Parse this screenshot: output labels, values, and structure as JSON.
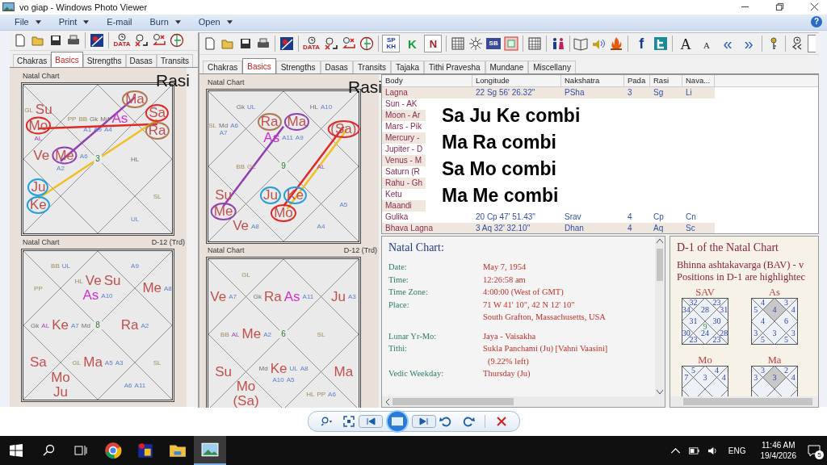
{
  "window": {
    "title": "vo giap - Windows Photo Viewer"
  },
  "menu": [
    {
      "label": "File",
      "dropdown": true
    },
    {
      "label": "Print",
      "dropdown": true
    },
    {
      "label": "E-mail",
      "dropdown": false
    },
    {
      "label": "Burn",
      "dropdown": true
    },
    {
      "label": "Open",
      "dropdown": true
    }
  ],
  "help": "?",
  "back_window": {
    "toolbar": [
      {
        "kind": "new"
      },
      {
        "kind": "open"
      },
      {
        "kind": "save"
      },
      {
        "kind": "print"
      },
      {
        "kind": "logo",
        "group_start": true
      },
      {
        "kind": "data",
        "text": "DATA",
        "group_start": true
      },
      {
        "kind": "clock-x"
      },
      {
        "kind": "clock-back"
      },
      {
        "kind": "globe"
      }
    ],
    "tabs": [
      {
        "label": "Chakras",
        "selected": false
      },
      {
        "label": "Basics",
        "selected": true
      },
      {
        "label": "Strengths",
        "selected": false
      },
      {
        "label": "Dasas",
        "selected": false
      },
      {
        "label": "Transits",
        "selected": false
      }
    ],
    "charts": [
      {
        "title": "Natal Chart",
        "varga": "Rasi",
        "kind": "stamp",
        "center": "3",
        "houses": [
          {
            "kind": "top-right",
            "labels": [
              {
                "text": "Ma",
                "kind": "planet",
                "circled": true,
                "color": "#b07850"
              }
            ]
          },
          {
            "kind": "left-top",
            "labels": [
              {
                "text": "GL",
                "kind": "special"
              },
              {
                "text": "Su",
                "kind": "planet",
                "circled": false
              },
              {
                "text": "Mo",
                "kind": "planet",
                "circled": true,
                "color": "#e02828"
              },
              {
                "text": "AL",
                "kind": "arudha-lagna"
              }
            ]
          },
          {
            "kind": "top",
            "labels": [
              {
                "text": "PP",
                "kind": "special"
              },
              {
                "text": "BB",
                "kind": "special"
              },
              {
                "text": "Gk",
                "kind": "upagraha"
              },
              {
                "text": "Md",
                "kind": "upagraha"
              },
              {
                "text": "As",
                "kind": "lagna"
              },
              {
                "text": "A1",
                "kind": "arudha"
              },
              {
                "text": "A9",
                "kind": "arudha"
              },
              {
                "text": "A4",
                "kind": "arudha"
              }
            ]
          },
          {
            "kind": "right-top",
            "labels": [
              {
                "text": "Sa",
                "kind": "planet",
                "circled": true,
                "color": "#e02828"
              },
              {
                "text": "Ra",
                "kind": "planet",
                "circled": true,
                "color": "#b07850"
              }
            ]
          },
          {
            "kind": "left",
            "labels": [
              {
                "text": "Ve",
                "kind": "planet",
                "circled": false
              },
              {
                "text": "Me",
                "kind": "planet",
                "circled": true,
                "color": "#9040b0"
              },
              {
                "text": "A6",
                "kind": "arudha"
              },
              {
                "text": "A2",
                "kind": "arudha"
              }
            ]
          },
          {
            "kind": "right",
            "labels": [
              {
                "text": "HL",
                "kind": "upagraha"
              }
            ]
          },
          {
            "kind": "left-bottom",
            "labels": [
              {
                "text": "Ju",
                "kind": "planet",
                "circled": true,
                "color": "#20a0e0"
              },
              {
                "text": "Ke",
                "kind": "planet",
                "circled": true,
                "color": "#20a0e0"
              }
            ]
          },
          {
            "kind": "right-bottom",
            "labels": [
              {
                "text": "SL",
                "kind": "special"
              }
            ]
          },
          {
            "kind": "bottom-right",
            "labels": [
              {
                "text": "UL",
                "kind": "arudha"
              }
            ]
          }
        ],
        "links": [
          {
            "kind": "left-to-top-right",
            "color": "#9040b0"
          },
          {
            "kind": "left-top-to-right-top",
            "color": "#e02828"
          },
          {
            "kind": "left-bottom-to-right-top",
            "color": "#f0c020"
          }
        ]
      },
      {
        "title": "Natal Chart",
        "varga": "D-12 (Trd)",
        "kind": "caption",
        "center": "8",
        "houses": [
          {
            "kind": "top-left",
            "labels": [
              {
                "text": "BB",
                "kind": "special"
              },
              {
                "text": "UL",
                "kind": "arudha"
              }
            ]
          },
          {
            "kind": "top-right",
            "labels": [
              {
                "text": "A9",
                "kind": "arudha"
              }
            ]
          },
          {
            "kind": "left-top",
            "labels": [
              {
                "text": "PP",
                "kind": "special"
              }
            ]
          },
          {
            "kind": "top",
            "labels": [
              {
                "text": "HL",
                "kind": "special"
              },
              {
                "text": "Ve",
                "kind": "planet",
                "circled": false
              },
              {
                "text": "Su",
                "kind": "planet",
                "circled": false
              },
              {
                "text": "As",
                "kind": "lagna"
              },
              {
                "text": "A10",
                "kind": "arudha"
              }
            ]
          },
          {
            "kind": "right-top",
            "labels": [
              {
                "text": "Me",
                "kind": "planet",
                "circled": false
              },
              {
                "text": "A8",
                "kind": "arudha"
              }
            ]
          },
          {
            "kind": "left",
            "labels": [
              {
                "text": "Gk",
                "kind": "upagraha"
              },
              {
                "text": "AL",
                "kind": "arudha-lagna"
              },
              {
                "text": "Ke",
                "kind": "planet",
                "circled": false
              },
              {
                "text": "A7",
                "kind": "arudha"
              },
              {
                "text": "Md",
                "kind": "upagraha"
              }
            ]
          },
          {
            "kind": "right",
            "labels": [
              {
                "text": "Ra",
                "kind": "planet",
                "circled": false
              },
              {
                "text": "A2",
                "kind": "arudha"
              }
            ]
          },
          {
            "kind": "left-bottom",
            "labels": [
              {
                "text": "Sa",
                "kind": "planet",
                "circled": false
              }
            ]
          },
          {
            "kind": "bottom",
            "labels": [
              {
                "text": "GL",
                "kind": "special"
              },
              {
                "text": "Ma",
                "kind": "planet",
                "circled": false
              },
              {
                "text": "A5",
                "kind": "arudha"
              },
              {
                "text": "A3",
                "kind": "arudha"
              }
            ]
          },
          {
            "kind": "right-bottom",
            "labels": [
              {
                "text": "SL",
                "kind": "special"
              }
            ]
          },
          {
            "kind": "bottom-left",
            "labels": [
              {
                "text": "Mo",
                "kind": "planet",
                "circled": false
              },
              {
                "text": "Ju",
                "kind": "planet",
                "circled": false
              }
            ]
          },
          {
            "kind": "bottom-right",
            "labels": [
              {
                "text": "A6",
                "kind": "arudha"
              },
              {
                "text": "A11",
                "kind": "arudha"
              }
            ]
          }
        ]
      }
    ]
  },
  "front_window": {
    "toolbar": [
      {
        "kind": "new"
      },
      {
        "kind": "open"
      },
      {
        "kind": "save"
      },
      {
        "kind": "print"
      },
      {
        "kind": "logo",
        "group_start": true
      },
      {
        "kind": "data",
        "text": "DATA",
        "group_start": true
      },
      {
        "kind": "clock-x"
      },
      {
        "kind": "clock-back"
      },
      {
        "kind": "globe"
      },
      {
        "kind": "sp",
        "lines": [
          "SP",
          "KH"
        ],
        "group_start": true
      },
      {
        "kind": "k",
        "text": "K"
      },
      {
        "kind": "n",
        "text": "N"
      },
      {
        "kind": "grid",
        "group_start": true
      },
      {
        "kind": "sun"
      },
      {
        "kind": "sb",
        "text": "SB"
      },
      {
        "kind": "square"
      },
      {
        "kind": "grid",
        "group_start": true
      },
      {
        "kind": "people",
        "group_start": true
      },
      {
        "kind": "book",
        "group_start": true
      },
      {
        "kind": "speaker"
      },
      {
        "kind": "fire"
      },
      {
        "kind": "f",
        "text": "f",
        "group_start": true
      },
      {
        "kind": "bird-box"
      },
      {
        "kind": "big-a",
        "text": "A",
        "group_start": true
      },
      {
        "kind": "small-a",
        "text": "A"
      },
      {
        "kind": "prev",
        "text": "«"
      },
      {
        "kind": "next",
        "text": "»"
      },
      {
        "kind": "key",
        "group_start": true
      },
      {
        "kind": "clock-prev",
        "group_start": true
      },
      {
        "kind": "field"
      }
    ],
    "tabs": [
      {
        "label": "Chakras",
        "selected": false
      },
      {
        "label": "Basics",
        "selected": true
      },
      {
        "label": "Strengths",
        "selected": false
      },
      {
        "label": "Dasas",
        "selected": false
      },
      {
        "label": "Transits",
        "selected": false
      },
      {
        "label": "Tajaka",
        "selected": false
      },
      {
        "label": "Tithi Pravesha",
        "selected": false
      },
      {
        "label": "Mundane",
        "selected": false
      },
      {
        "label": "Miscellany",
        "selected": false
      }
    ],
    "charts": [
      {
        "title": "Natal Chart",
        "varga": "Rasi",
        "kind": "stamp",
        "center": "9",
        "houses": [
          {
            "kind": "top-left",
            "labels": [
              {
                "text": "Gk",
                "kind": "upagraha"
              },
              {
                "text": "UL",
                "kind": "arudha"
              }
            ]
          },
          {
            "kind": "top-right",
            "labels": [
              {
                "text": "HL",
                "kind": "upagraha"
              },
              {
                "text": "A10",
                "kind": "arudha"
              }
            ]
          },
          {
            "kind": "left-top",
            "labels": [
              {
                "text": "SL",
                "kind": "special"
              },
              {
                "text": "Md",
                "kind": "upagraha"
              },
              {
                "text": "A6",
                "kind": "arudha"
              },
              {
                "text": "A7",
                "kind": "arudha"
              }
            ]
          },
          {
            "kind": "top",
            "labels": [
              {
                "text": "Ra",
                "kind": "planet",
                "circled": true,
                "color": "#b07850"
              },
              {
                "text": "Ma",
                "kind": "planet",
                "circled": true,
                "color": "#9040b0"
              },
              {
                "text": "As",
                "kind": "lagna"
              },
              {
                "text": "A11",
                "kind": "arudha"
              },
              {
                "text": "A9",
                "kind": "arudha"
              }
            ]
          },
          {
            "kind": "right-top",
            "labels": [
              {
                "text": "(Sa)",
                "kind": "planet",
                "circled": true,
                "color": "#e02828"
              }
            ]
          },
          {
            "kind": "left",
            "labels": [
              {
                "text": "BB",
                "kind": "special"
              },
              {
                "text": "GL",
                "kind": "special"
              }
            ]
          },
          {
            "kind": "right",
            "labels": [
              {
                "text": "AL",
                "kind": "arudha-lagna"
              }
            ]
          },
          {
            "kind": "left-bottom",
            "labels": [
              {
                "text": "Su",
                "kind": "planet",
                "circled": false
              },
              {
                "text": "Me",
                "kind": "planet",
                "circled": true,
                "color": "#9040b0"
              }
            ]
          },
          {
            "kind": "bottom",
            "labels": [
              {
                "text": "Ju",
                "kind": "planet",
                "circled": true,
                "color": "#20a0e0"
              },
              {
                "text": "Ke",
                "kind": "planet",
                "circled": true,
                "color": "#20a0e0"
              },
              {
                "text": "Mo",
                "kind": "planet",
                "circled": true,
                "color": "#e02828"
              }
            ]
          },
          {
            "kind": "right-bottom",
            "labels": [
              {
                "text": "A5",
                "kind": "arudha"
              }
            ]
          },
          {
            "kind": "bottom-left",
            "labels": [
              {
                "text": "Ve",
                "kind": "planet",
                "circled": false
              },
              {
                "text": "A8",
                "kind": "arudha"
              }
            ]
          },
          {
            "kind": "bottom-right",
            "labels": [
              {
                "text": "A4",
                "kind": "arudha"
              }
            ]
          }
        ],
        "links": [
          {
            "kind": "left-bottom-to-top",
            "color": "#9040b0"
          },
          {
            "kind": "bottom-to-right-top",
            "color": "#f0c020"
          },
          {
            "kind": "bottom-to-right-top",
            "color": "#e02828"
          }
        ]
      },
      {
        "title": "Natal Chart",
        "varga": "D-12 (Trd)",
        "kind": "caption",
        "center": "6",
        "houses": [
          {
            "kind": "top-left",
            "labels": [
              {
                "text": "GL",
                "kind": "special"
              }
            ]
          },
          {
            "kind": "left-top",
            "labels": [
              {
                "text": "Ve",
                "kind": "planet",
                "circled": false
              },
              {
                "text": "A7",
                "kind": "arudha"
              }
            ]
          },
          {
            "kind": "top",
            "labels": [
              {
                "text": "Gk",
                "kind": "upagraha"
              },
              {
                "text": "Ra",
                "kind": "planet",
                "circled": false
              },
              {
                "text": "As",
                "kind": "lagna"
              },
              {
                "text": "A11",
                "kind": "arudha"
              }
            ]
          },
          {
            "kind": "right-top",
            "labels": [
              {
                "text": "Ju",
                "kind": "planet",
                "circled": false
              },
              {
                "text": "A3",
                "kind": "arudha"
              }
            ]
          },
          {
            "kind": "left",
            "labels": [
              {
                "text": "BB",
                "kind": "special"
              },
              {
                "text": "AL",
                "kind": "arudha-lagna"
              },
              {
                "text": "Me",
                "kind": "planet",
                "circled": false
              },
              {
                "text": "A2",
                "kind": "arudha"
              }
            ]
          },
          {
            "kind": "right",
            "labels": [
              {
                "text": "SL",
                "kind": "special"
              }
            ]
          },
          {
            "kind": "left-bottom",
            "labels": [
              {
                "text": "Su",
                "kind": "planet",
                "circled": false
              }
            ]
          },
          {
            "kind": "bottom",
            "labels": [
              {
                "text": "Md",
                "kind": "upagraha"
              },
              {
                "text": "Ke",
                "kind": "planet",
                "circled": false
              },
              {
                "text": "UL",
                "kind": "arudha"
              },
              {
                "text": "A8",
                "kind": "arudha"
              },
              {
                "text": "A10",
                "kind": "arudha"
              },
              {
                "text": "A5",
                "kind": "arudha"
              }
            ]
          },
          {
            "kind": "right-bottom",
            "labels": [
              {
                "text": "Ma",
                "kind": "planet",
                "circled": false
              }
            ]
          },
          {
            "kind": "bottom-left",
            "labels": [
              {
                "text": "Mo",
                "kind": "planet",
                "circled": false
              },
              {
                "text": "(Sa)",
                "kind": "planet",
                "circled": false
              }
            ]
          },
          {
            "kind": "bottom-right",
            "labels": [
              {
                "text": "HL",
                "kind": "special"
              },
              {
                "text": "PP",
                "kind": "special"
              },
              {
                "text": "A6",
                "kind": "arudha"
              }
            ]
          }
        ]
      }
    ],
    "table": {
      "columns": [
        "Body",
        "Longitude",
        "Nakshatra",
        "Pada",
        "Rasi",
        "Nava..."
      ],
      "rows": [
        {
          "body": "Lagna",
          "longitude": "22 Sg 56' 26.32\"",
          "nakshatra": "PSha",
          "pada": "3",
          "rasi": "Sg",
          "navamsa": "Li"
        },
        {
          "body": "Sun - AK"
        },
        {
          "body": "Moon - Ar"
        },
        {
          "body": "Mars - Pik"
        },
        {
          "body": "Mercury -"
        },
        {
          "body": "Jupiter - D"
        },
        {
          "body": "Venus - M"
        },
        {
          "body": "Saturn (R"
        },
        {
          "body": "Rahu - Gh"
        },
        {
          "body": "Ketu"
        },
        {
          "body": "Maandi"
        },
        {
          "body": "Gulika",
          "longitude": "20 Cp 47' 51.43\"",
          "nakshatra": "Srav",
          "pada": "4",
          "rasi": "Cp",
          "navamsa": "Cn"
        },
        {
          "body": "Bhava Lagna",
          "longitude": "3 Aq 32' 32.10\"",
          "nakshatra": "Dhan",
          "pada": "4",
          "rasi": "Aq",
          "navamsa": "Sc"
        }
      ]
    },
    "overlay_notes": [
      "Sa Ju Ke combi",
      "Ma Ra combi",
      "Sa Mo combi",
      "Ma Me combi"
    ],
    "details": {
      "title": "Natal Chart:",
      "sections": [
        [
          {
            "label": "Date:",
            "value": "May 7, 1954"
          },
          {
            "label": "Time:",
            "value": "12:26:58 am"
          },
          {
            "label": "Time Zone:",
            "value": "4:00:00 (West of GMT)"
          },
          {
            "label": "Place:",
            "value": "71 W 41' 10\", 42 N 12' 10\""
          },
          {
            "value": "South Grafton, Massachusetts, USA"
          }
        ],
        [
          {
            "label": "Lunar Yr-Mo:",
            "value": "Jaya - Vaisakha"
          },
          {
            "label": "Tithi:",
            "value": "Sukla Panchami (Ju) [Vahni Vaasini]"
          },
          {
            "value": "(9.22% left)",
            "indent": true
          },
          {
            "label": "Vedic Weekday:",
            "value": "Thursday (Ju)"
          }
        ]
      ]
    },
    "ashtakavarga": {
      "title": "D-1 of the Natal Chart",
      "lines": [
        "Bhinna ashtakavarga (BAV) - v",
        "Positions in D-1 are highlightec"
      ],
      "charts": [
        {
          "name": "SAV",
          "center": "9",
          "houses": [
            {
              "kind": "top-left",
              "value": "32",
              "highlighted": false
            },
            {
              "kind": "top-right",
              "value": "23",
              "highlighted": false
            },
            {
              "kind": "left-top",
              "value": "34",
              "highlighted": false
            },
            {
              "kind": "top",
              "value": "28",
              "highlighted": false
            },
            {
              "kind": "right-top",
              "value": "31",
              "highlighted": false
            },
            {
              "kind": "left",
              "value": "31",
              "highlighted": false
            },
            {
              "kind": "right",
              "value": "30",
              "highlighted": false
            },
            {
              "kind": "left-bottom",
              "value": "30",
              "highlighted": false
            },
            {
              "kind": "bottom",
              "value": "24",
              "highlighted": false
            },
            {
              "kind": "right-bottom",
              "value": "28",
              "highlighted": false
            },
            {
              "kind": "bottom-left",
              "value": "23",
              "highlighted": false
            },
            {
              "kind": "bottom-right",
              "value": "23",
              "highlighted": false
            }
          ]
        },
        {
          "name": "As",
          "houses": [
            {
              "kind": "top-left",
              "value": "4",
              "highlighted": false
            },
            {
              "kind": "top-right",
              "value": "3",
              "highlighted": false
            },
            {
              "kind": "left-top",
              "value": "5",
              "highlighted": false
            },
            {
              "kind": "top",
              "value": "4",
              "highlighted": true
            },
            {
              "kind": "right-top",
              "value": "4",
              "highlighted": false
            },
            {
              "kind": "left",
              "value": "4",
              "highlighted": false
            },
            {
              "kind": "right",
              "value": "6",
              "highlighted": false
            },
            {
              "kind": "left-bottom",
              "value": "3",
              "highlighted": false
            },
            {
              "kind": "bottom",
              "value": "3",
              "highlighted": false
            },
            {
              "kind": "right-bottom",
              "value": "3",
              "highlighted": false
            },
            {
              "kind": "bottom-left",
              "value": "5",
              "highlighted": false
            },
            {
              "kind": "bottom-right",
              "value": "5",
              "highlighted": false
            }
          ]
        },
        {
          "name": "Mo",
          "houses": [
            {
              "kind": "top-left",
              "value": "5",
              "highlighted": false
            },
            {
              "kind": "top-right",
              "value": "4",
              "highlighted": false
            },
            {
              "kind": "left-top",
              "value": "7",
              "highlighted": false
            },
            {
              "kind": "top",
              "value": "3",
              "highlighted": false
            },
            {
              "kind": "right-top",
              "value": "4",
              "highlighted": false
            }
          ]
        },
        {
          "name": "Ma",
          "houses": [
            {
              "kind": "top-left",
              "value": "3",
              "highlighted": false
            },
            {
              "kind": "top-right",
              "value": "2",
              "highlighted": false
            },
            {
              "kind": "left-top",
              "value": "3",
              "highlighted": false
            },
            {
              "kind": "top",
              "value": "3",
              "highlighted": true
            },
            {
              "kind": "right-top",
              "value": "4",
              "highlighted": false
            }
          ]
        }
      ]
    }
  },
  "viewer_controls": [
    {
      "kind": "zoom"
    },
    {
      "kind": "fit"
    },
    {
      "kind": "previous"
    },
    {
      "kind": "slideshow"
    },
    {
      "kind": "next"
    },
    {
      "kind": "rotate-left"
    },
    {
      "kind": "rotate-right"
    },
    {
      "kind": "delete"
    }
  ],
  "taskbar": {
    "apps": [
      {
        "kind": "start",
        "selected": false
      },
      {
        "kind": "search",
        "selected": false
      },
      {
        "kind": "task-view",
        "selected": false
      },
      {
        "kind": "browser",
        "selected": false
      },
      {
        "kind": "astro-app",
        "selected": false
      },
      {
        "kind": "folder",
        "selected": false
      },
      {
        "kind": "photos",
        "selected": true
      }
    ],
    "language": "ENG",
    "time": "11:46 AM",
    "date": "19/4/2026",
    "notifications": "5"
  }
}
